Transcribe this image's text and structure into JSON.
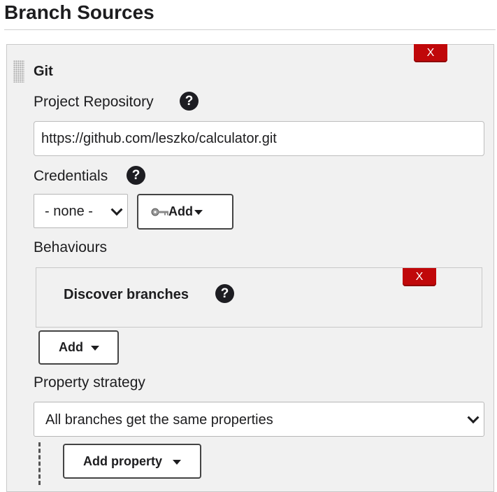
{
  "section": {
    "title": "Branch Sources"
  },
  "source": {
    "type_label": "Git",
    "delete_label": "X",
    "project_repository": {
      "label": "Project Repository",
      "value": "https://github.com/leszko/calculator.git"
    },
    "credentials": {
      "label": "Credentials",
      "selected": "- none -",
      "add_label": "Add"
    },
    "behaviours": {
      "label": "Behaviours",
      "items": [
        {
          "label": "Discover branches",
          "delete_label": "X"
        }
      ],
      "add_label": "Add"
    },
    "property_strategy": {
      "label": "Property strategy",
      "selected": "All branches get the same properties",
      "add_property_label": "Add property"
    }
  },
  "help_glyph": "?",
  "colors": {
    "delete_button": "#c0080a",
    "help_icon": "#1d1d22",
    "panel_background": "#f1f1f1"
  },
  "icons": [
    "drag-handle-icon",
    "help-icon",
    "key-icon",
    "caret-down-icon",
    "chevron-down-icon"
  ]
}
